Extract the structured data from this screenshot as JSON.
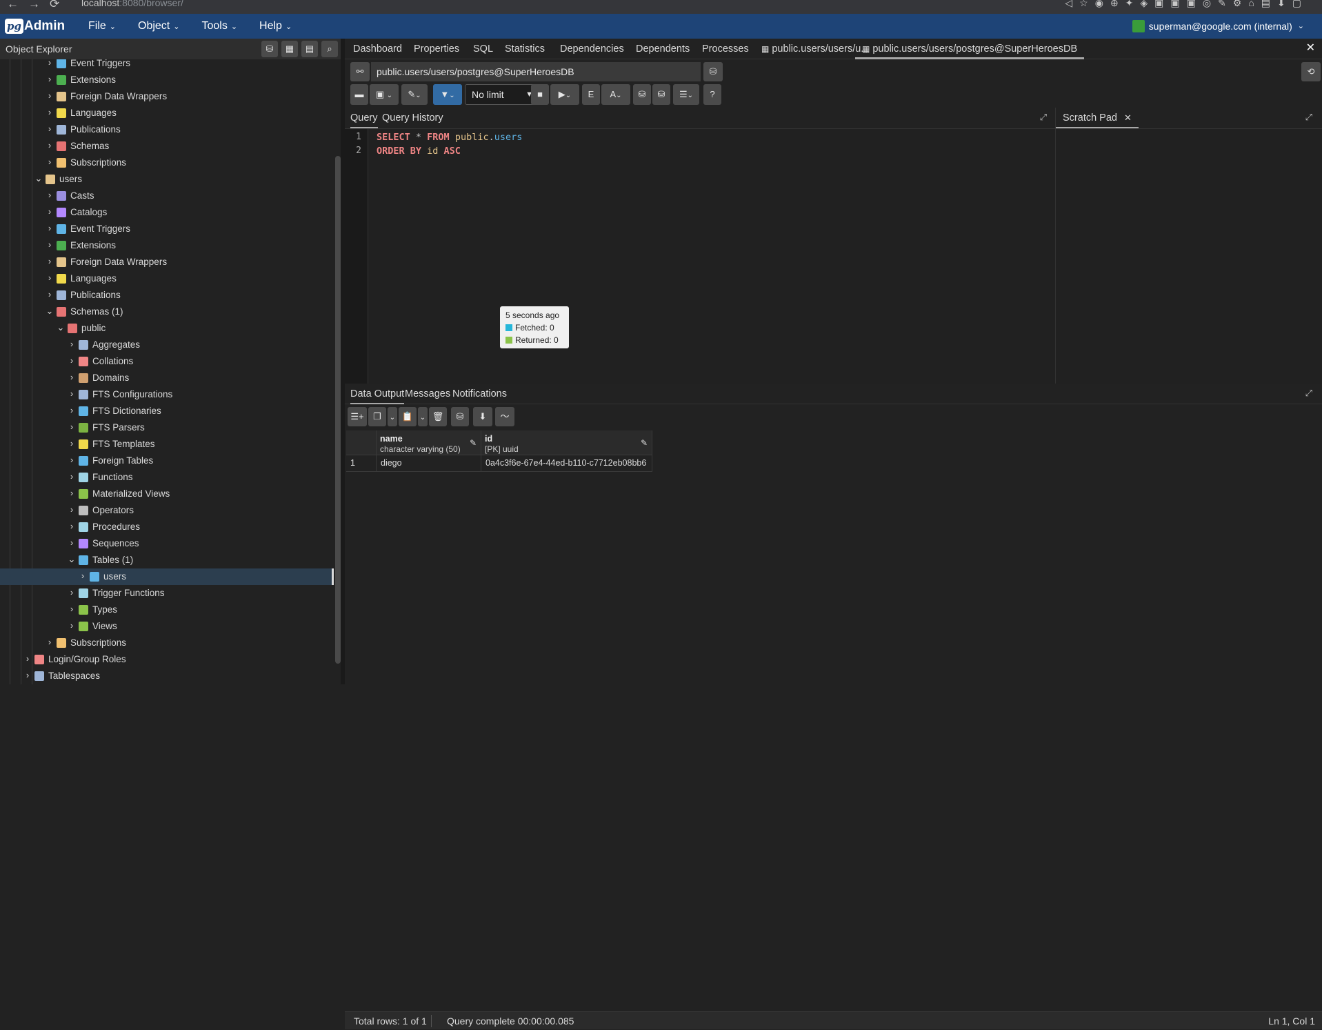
{
  "browser": {
    "url_host": "localhost",
    "url_path": ":8080/browser/"
  },
  "app": {
    "logo_pg": "pg",
    "logo_admin": "Admin",
    "menus": [
      "File",
      "Object",
      "Tools",
      "Help"
    ],
    "user": "superman@google.com (internal)"
  },
  "object_explorer": {
    "title": "Object Explorer",
    "tree": [
      {
        "label": "Event Triggers",
        "depth": 1,
        "expanded": false,
        "icon": "event-triggers-icon",
        "color": "#5fb4e6"
      },
      {
        "label": "Extensions",
        "depth": 1,
        "expanded": false,
        "icon": "extensions-icon",
        "color": "#4caf50"
      },
      {
        "label": "Foreign Data Wrappers",
        "depth": 1,
        "expanded": false,
        "icon": "foreign-data-wrappers-icon",
        "color": "#e4c48b"
      },
      {
        "label": "Languages",
        "depth": 1,
        "expanded": false,
        "icon": "languages-icon",
        "color": "#f1d94b"
      },
      {
        "label": "Publications",
        "depth": 1,
        "expanded": false,
        "icon": "publications-icon",
        "color": "#9fb6d8"
      },
      {
        "label": "Schemas",
        "depth": 1,
        "expanded": false,
        "icon": "schemas-icon",
        "color": "#e57373"
      },
      {
        "label": "Subscriptions",
        "depth": 1,
        "expanded": false,
        "icon": "subscriptions-icon",
        "color": "#f0c070"
      },
      {
        "label": "users",
        "depth": 0,
        "expanded": true,
        "icon": "database-icon",
        "color": "#e4c48b"
      },
      {
        "label": "Casts",
        "depth": 1,
        "expanded": false,
        "icon": "casts-icon",
        "color": "#9b8fe0"
      },
      {
        "label": "Catalogs",
        "depth": 1,
        "expanded": false,
        "icon": "catalogs-icon",
        "color": "#b388ff"
      },
      {
        "label": "Event Triggers",
        "depth": 1,
        "expanded": false,
        "icon": "event-triggers-icon",
        "color": "#5fb4e6"
      },
      {
        "label": "Extensions",
        "depth": 1,
        "expanded": false,
        "icon": "extensions-icon",
        "color": "#4caf50"
      },
      {
        "label": "Foreign Data Wrappers",
        "depth": 1,
        "expanded": false,
        "icon": "foreign-data-wrappers-icon",
        "color": "#e4c48b"
      },
      {
        "label": "Languages",
        "depth": 1,
        "expanded": false,
        "icon": "languages-icon",
        "color": "#f1d94b"
      },
      {
        "label": "Publications",
        "depth": 1,
        "expanded": false,
        "icon": "publications-icon",
        "color": "#9fb6d8"
      },
      {
        "label": "Schemas (1)",
        "depth": 1,
        "expanded": true,
        "icon": "schemas-icon",
        "color": "#e57373"
      },
      {
        "label": "public",
        "depth": 2,
        "expanded": true,
        "icon": "schema-icon",
        "color": "#e57373"
      },
      {
        "label": "Aggregates",
        "depth": 3,
        "expanded": false,
        "icon": "aggregates-icon",
        "color": "#9fb6d8"
      },
      {
        "label": "Collations",
        "depth": 3,
        "expanded": false,
        "icon": "collations-icon",
        "color": "#ef8585"
      },
      {
        "label": "Domains",
        "depth": 3,
        "expanded": false,
        "icon": "domains-icon",
        "color": "#d0a070"
      },
      {
        "label": "FTS Configurations",
        "depth": 3,
        "expanded": false,
        "icon": "fts-configurations-icon",
        "color": "#9fb6d8"
      },
      {
        "label": "FTS Dictionaries",
        "depth": 3,
        "expanded": false,
        "icon": "fts-dictionaries-icon",
        "color": "#5fb4e6"
      },
      {
        "label": "FTS Parsers",
        "depth": 3,
        "expanded": false,
        "icon": "fts-parsers-icon",
        "color": "#7cb342"
      },
      {
        "label": "FTS Templates",
        "depth": 3,
        "expanded": false,
        "icon": "fts-templates-icon",
        "color": "#f1d94b"
      },
      {
        "label": "Foreign Tables",
        "depth": 3,
        "expanded": false,
        "icon": "foreign-tables-icon",
        "color": "#5fb4e6"
      },
      {
        "label": "Functions",
        "depth": 3,
        "expanded": false,
        "icon": "functions-icon",
        "color": "#9fd4e6"
      },
      {
        "label": "Materialized Views",
        "depth": 3,
        "expanded": false,
        "icon": "materialized-views-icon",
        "color": "#8bc34a"
      },
      {
        "label": "Operators",
        "depth": 3,
        "expanded": false,
        "icon": "operators-icon",
        "color": "#bdbdbd"
      },
      {
        "label": "Procedures",
        "depth": 3,
        "expanded": false,
        "icon": "procedures-icon",
        "color": "#9fd4e6"
      },
      {
        "label": "Sequences",
        "depth": 3,
        "expanded": false,
        "icon": "sequences-icon",
        "color": "#b388ff"
      },
      {
        "label": "Tables (1)",
        "depth": 3,
        "expanded": true,
        "icon": "tables-icon",
        "color": "#5fb4e6"
      },
      {
        "label": "users",
        "depth": 4,
        "expanded": false,
        "icon": "table-icon",
        "color": "#5fb4e6",
        "selected": true
      },
      {
        "label": "Trigger Functions",
        "depth": 3,
        "expanded": false,
        "icon": "trigger-functions-icon",
        "color": "#9fd4e6"
      },
      {
        "label": "Types",
        "depth": 3,
        "expanded": false,
        "icon": "types-icon",
        "color": "#8bc34a"
      },
      {
        "label": "Views",
        "depth": 3,
        "expanded": false,
        "icon": "views-icon",
        "color": "#8bc34a"
      },
      {
        "label": "Subscriptions",
        "depth": 1,
        "expanded": false,
        "icon": "subscriptions-icon",
        "color": "#f0c070"
      },
      {
        "label": "Login/Group Roles",
        "depth": -1,
        "expanded": false,
        "icon": "login-roles-icon",
        "color": "#ef8585"
      },
      {
        "label": "Tablespaces",
        "depth": -1,
        "expanded": false,
        "icon": "tablespaces-icon",
        "color": "#9fb6d8"
      }
    ]
  },
  "tabs": [
    {
      "label": "Dashboard",
      "active": false
    },
    {
      "label": "Properties",
      "active": false
    },
    {
      "label": "SQL",
      "active": false
    },
    {
      "label": "Statistics",
      "active": false
    },
    {
      "label": "Dependencies",
      "active": false
    },
    {
      "label": "Dependents",
      "active": false
    },
    {
      "label": "Processes",
      "active": false
    },
    {
      "label": "public.users/users/u...",
      "active": false
    },
    {
      "label": "public.users/users/postgres@SuperHeroesDB",
      "active": true
    }
  ],
  "connection": "public.users/users/postgres@SuperHeroesDB",
  "limit": "No limit",
  "query_tabs": [
    "Query",
    "Query History"
  ],
  "query_lines": [
    {
      "num": "1",
      "tokens": [
        {
          "t": "SELECT",
          "c": "kw"
        },
        {
          "t": " * ",
          "c": "op"
        },
        {
          "t": "FROM",
          "c": "kw"
        },
        {
          "t": " public",
          "c": "sch"
        },
        {
          "t": ".",
          "c": "op"
        },
        {
          "t": "users",
          "c": "obj"
        }
      ]
    },
    {
      "num": "2",
      "tokens": [
        {
          "t": "ORDER BY",
          "c": "kw"
        },
        {
          "t": " id ",
          "c": "sch"
        },
        {
          "t": "ASC",
          "c": "kw"
        }
      ]
    }
  ],
  "scratch_pad": "Scratch Pad",
  "tooltip": {
    "time": "5 seconds ago",
    "fetched": "Fetched: 0",
    "returned": "Returned: 0",
    "fetched_color": "#26b6d9",
    "returned_color": "#8bc34a"
  },
  "result_tabs": [
    "Data Output",
    "Messages",
    "Notifications"
  ],
  "grid": {
    "columns": [
      {
        "name": "name",
        "type": "character varying (50)"
      },
      {
        "name": "id",
        "type": "[PK] uuid"
      }
    ],
    "rows": [
      {
        "num": "1",
        "cells": [
          "diego",
          "0a4c3f6e-67e4-44ed-b110-c7712eb08bb6"
        ]
      }
    ]
  },
  "status": {
    "total": "Total rows: 1 of 1",
    "complete": "Query complete 00:00:00.085",
    "position": "Ln 1, Col 1"
  }
}
